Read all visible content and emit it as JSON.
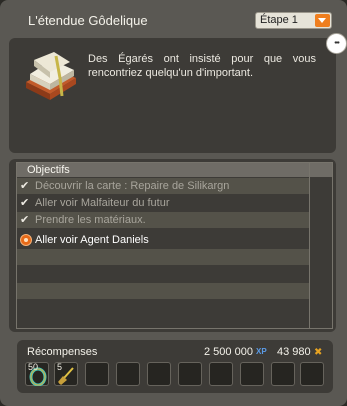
{
  "window": {
    "title": "L'étendue Gôdelique",
    "step_select": {
      "selected": "Étape 1"
    }
  },
  "description": {
    "text": "Des Égarés ont insisté pour que vous rencontriez quelqu'un d'important."
  },
  "objectives": {
    "header": "Objectifs",
    "items": [
      {
        "label": "Découvrir la carte : Repaire de Silikargn",
        "status": "done"
      },
      {
        "label": "Aller voir Malfaiteur du futur",
        "status": "done"
      },
      {
        "label": "Prendre les matériaux.",
        "status": "done"
      },
      {
        "label": "Aller voir Agent Daniels",
        "status": "active"
      }
    ]
  },
  "rewards": {
    "title": "Récompenses",
    "xp": "2 500 000",
    "kamas": "43 980",
    "items": [
      {
        "count": "50",
        "icon": "ring-icon"
      },
      {
        "count": "5",
        "icon": "broom-icon"
      }
    ],
    "empty_slots": 8
  },
  "icons": {
    "check": "✔",
    "more": "•••"
  }
}
